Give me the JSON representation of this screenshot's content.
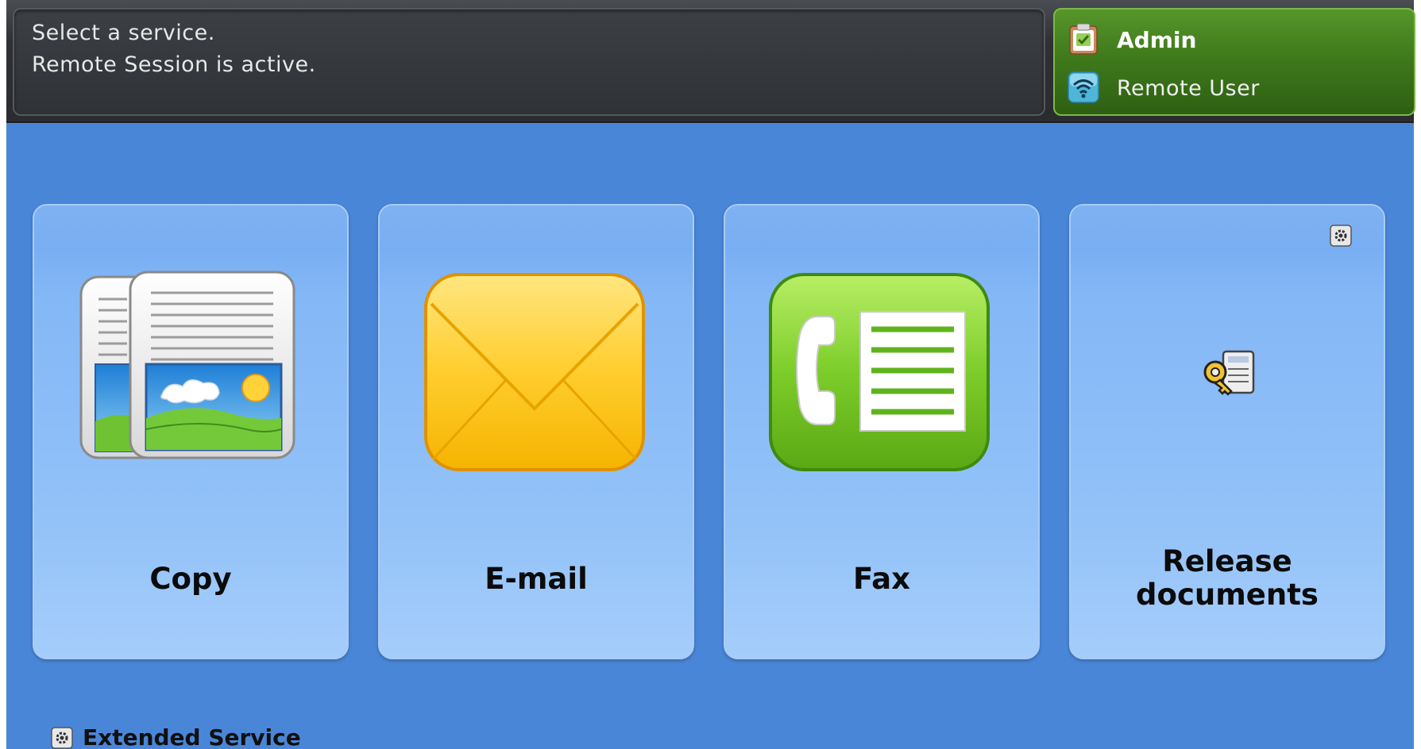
{
  "status": {
    "message_line_1": "Select a service.",
    "message_line_2": "Remote Session is active.",
    "user_role": "Admin",
    "session_type": "Remote User"
  },
  "services": [
    {
      "label": "Copy",
      "icon": "copy-icon"
    },
    {
      "label": "E-mail",
      "icon": "envelope-icon"
    },
    {
      "label": "Fax",
      "icon": "fax-icon"
    },
    {
      "label_line_1": "Release",
      "label_line_2": "documents",
      "icon": "key-document-icon"
    }
  ],
  "extended_service": {
    "label": "Extended Service",
    "icon": "settings-icon"
  },
  "colors": {
    "status_bar": "#2e3034",
    "user_panel": "#3f7a1c",
    "main_background": "#4a86d8",
    "tile": "#84b7f6"
  }
}
